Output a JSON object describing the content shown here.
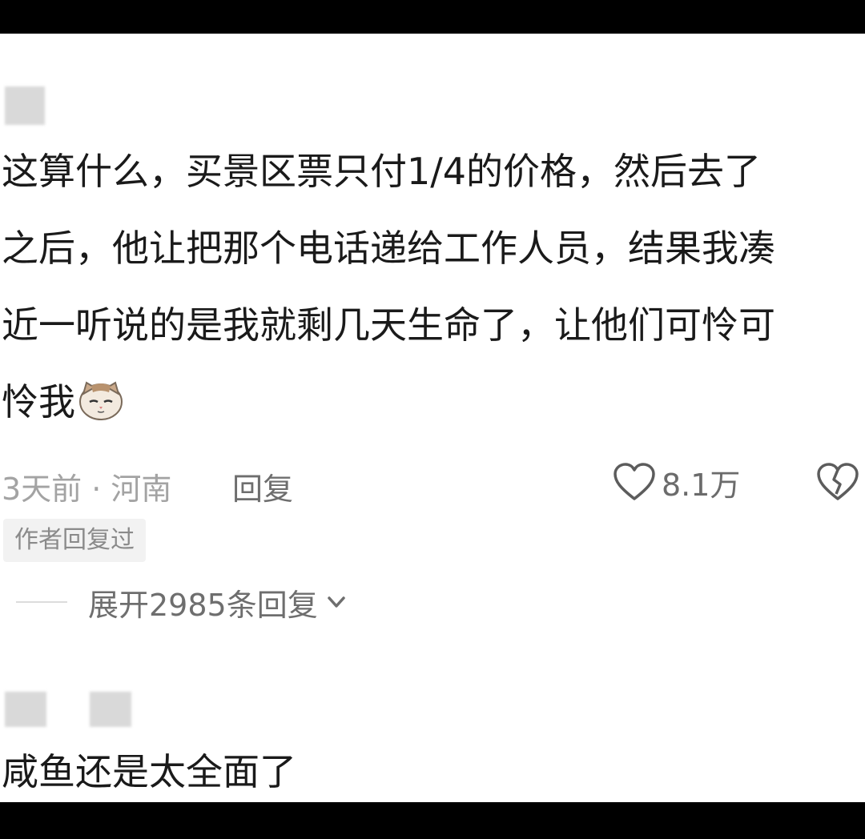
{
  "comment1": {
    "lines": [
      "这算什么，买景区票只付1/4的价格，然后去了",
      "之后，他让把那个电话递给工作人员，结果我凑",
      "近一听说的是我就剩几天生命了，让他们可怜可",
      "怜我"
    ],
    "emoji": "cat-emoji",
    "time_location": "3天前 · 河南",
    "reply_label": "回复",
    "like_count": "8.1万",
    "author_badge": "作者回复过",
    "expand_label": "展开2985条回复"
  },
  "comment2": {
    "text": "咸鱼还是太全面了"
  },
  "icons": {
    "like": "heart-outline-icon",
    "dislike": "broken-heart-icon",
    "expand": "chevron-down-icon"
  },
  "colors": {
    "background": "#ffffff",
    "text": "#1a1a1a",
    "meta": "#a3a3a3"
  }
}
